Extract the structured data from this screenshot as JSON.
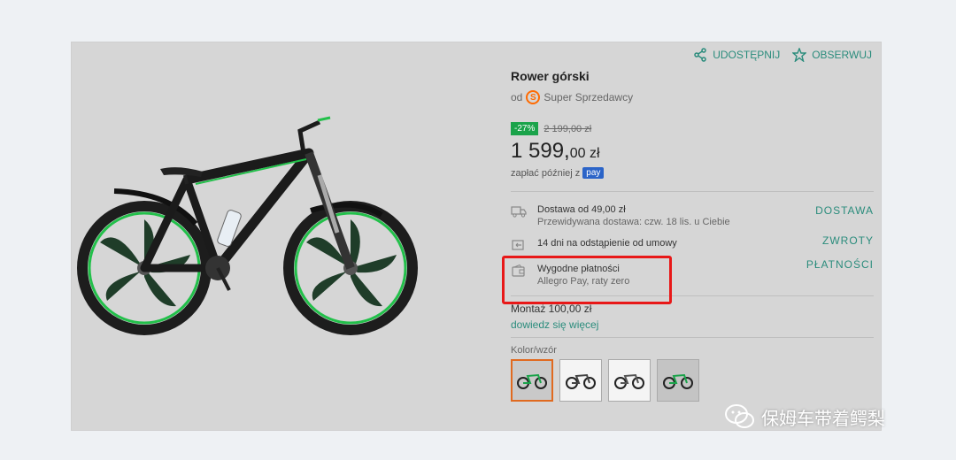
{
  "header": {
    "share_label": "UDOSTĘPNIJ",
    "follow_label": "OBSERWUJ"
  },
  "product": {
    "title": "Rower górski",
    "seller_prefix": "od",
    "seller_name": "Super Sprzedawcy",
    "discount": "-27%",
    "old_price": "2 199,00 zł",
    "price_main": "1 599,",
    "price_rest": "00 zł",
    "pay_later_text": "zapłać później z",
    "pay_badge": "pay"
  },
  "details": {
    "delivery": {
      "title": "Dostawa od 49,00 zł",
      "subtitle": "Przewidywana dostawa: czw. 18 lis. u Ciebie",
      "link": "DOSTAWA"
    },
    "returns": {
      "title": "14 dni na odstąpienie od umowy",
      "link": "ZWROTY"
    },
    "payments": {
      "title": "Wygodne płatności",
      "subtitle": "Allegro Pay, raty zero",
      "link": "PŁATNOŚCI"
    }
  },
  "assembly": {
    "text": "Montaż 100,00 zł",
    "link": "dowiedz się więcej"
  },
  "variants": {
    "label": "Kolor/wzór",
    "count": 4,
    "selected_index": 0
  },
  "colors": {
    "accent": "#2a8c7c",
    "discount": "#1aa34a",
    "highlight": "#e81818",
    "selected_border": "#e06a20"
  },
  "watermark": {
    "text": "保姆车带着鳄梨"
  }
}
